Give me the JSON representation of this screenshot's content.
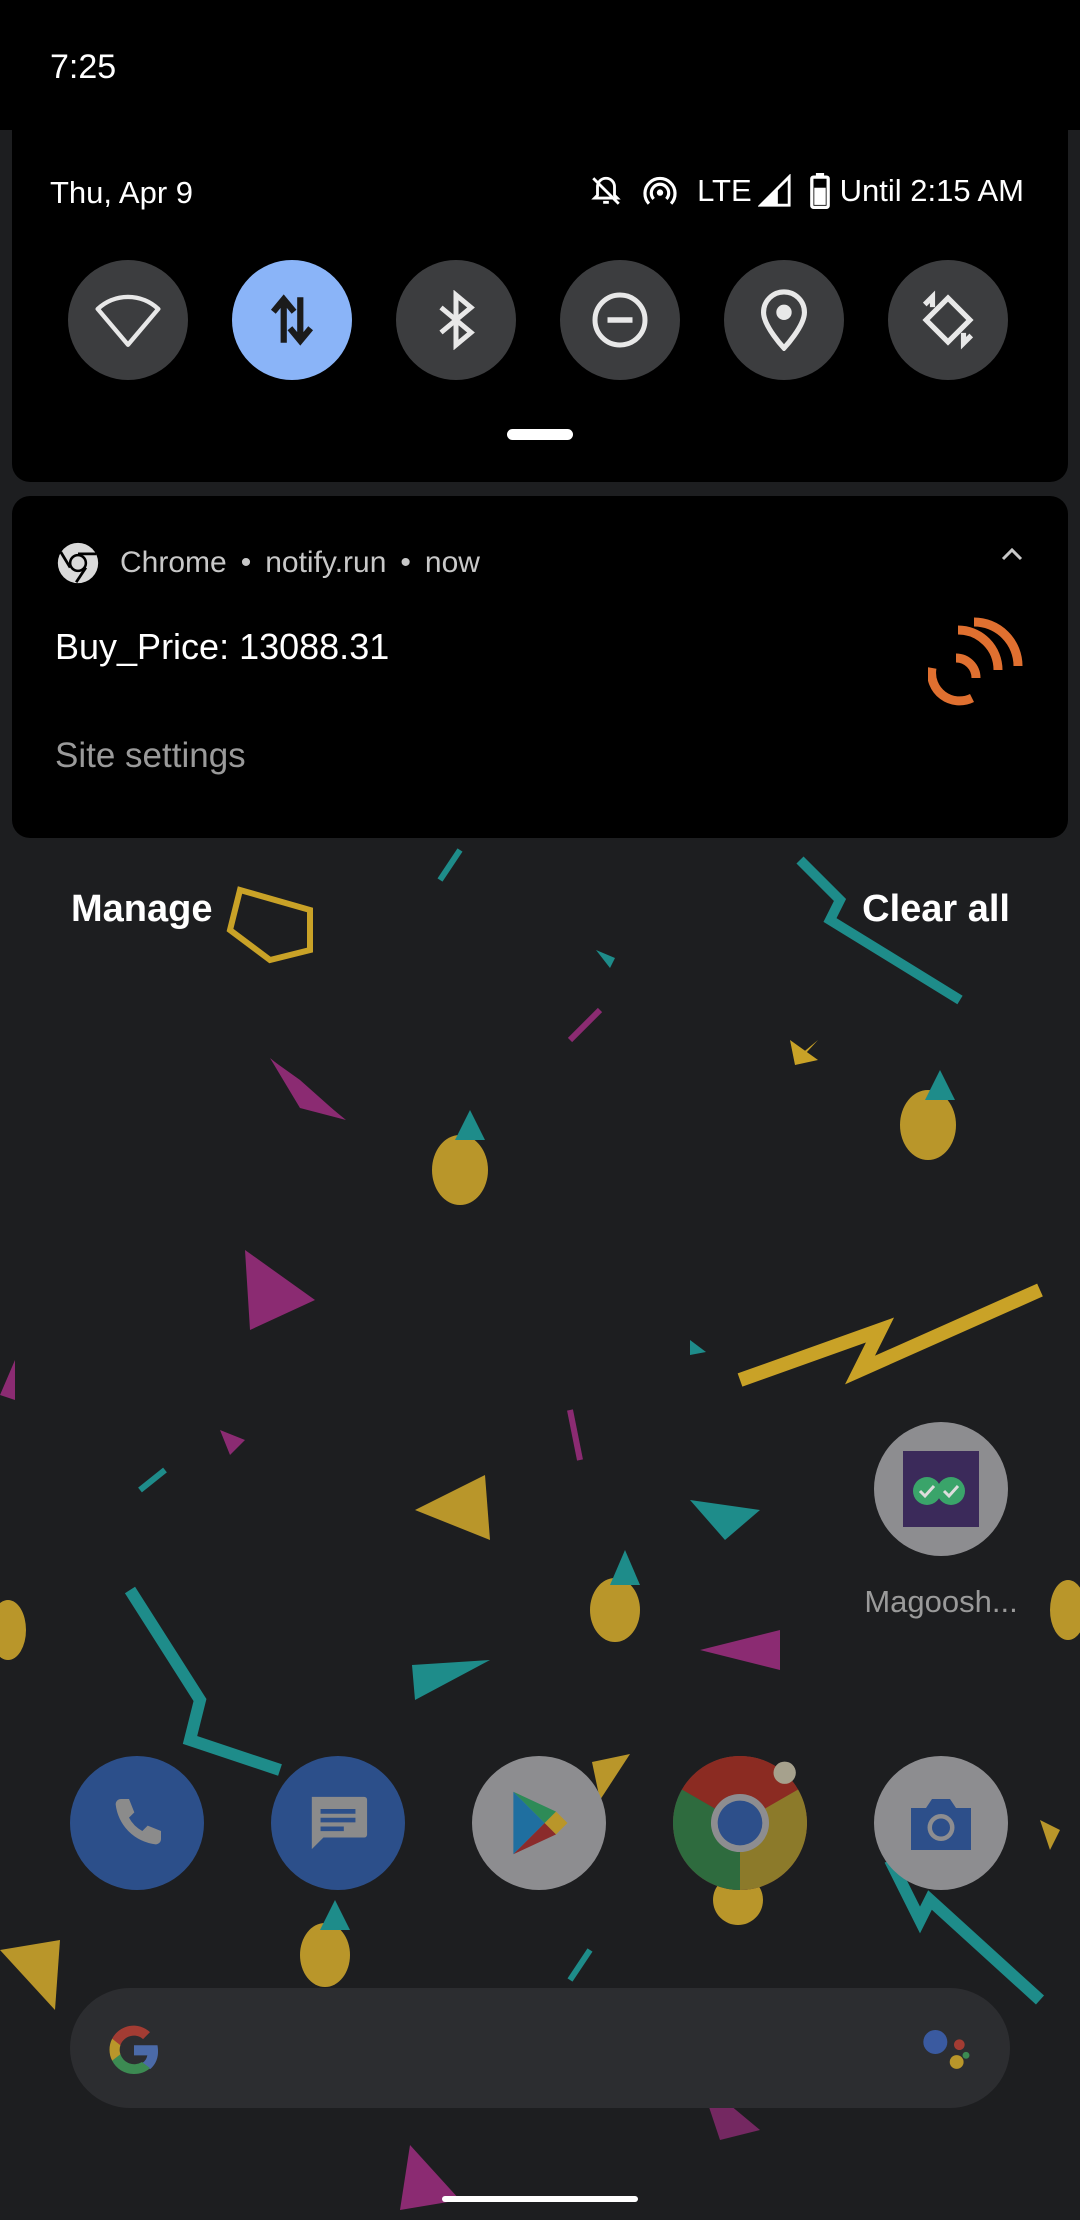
{
  "status_bar": {
    "time": "7:25"
  },
  "quick_settings": {
    "date": "Thu, Apr 9",
    "network_label": "LTE",
    "battery_text": "Until 2:15 AM",
    "status_icons": [
      "bell-off-icon",
      "hotspot-icon",
      "signal-icon",
      "battery-icon"
    ],
    "tiles": [
      {
        "name": "wifi",
        "icon": "wifi-icon",
        "active": false
      },
      {
        "name": "mobile-data",
        "icon": "data-arrows-icon",
        "active": true
      },
      {
        "name": "bluetooth",
        "icon": "bluetooth-icon",
        "active": false
      },
      {
        "name": "do-not-disturb",
        "icon": "dnd-icon",
        "active": false
      },
      {
        "name": "location",
        "icon": "location-pin-icon",
        "active": false
      },
      {
        "name": "auto-rotate",
        "icon": "rotate-icon",
        "active": false
      }
    ],
    "active_color": "#8ab4f8"
  },
  "notification": {
    "app_name": "Chrome",
    "sep1": "•",
    "site": "notify.run",
    "sep2": "•",
    "time": "now",
    "title": "Buy_Price: 13088.31",
    "action": "Site settings"
  },
  "shade_actions": {
    "manage": "Manage",
    "clear_all": "Clear all"
  },
  "home": {
    "app_label": "Magoosh...",
    "dock": [
      "phone-icon",
      "messages-icon",
      "play-store-icon",
      "chrome-icon",
      "camera-icon"
    ]
  }
}
